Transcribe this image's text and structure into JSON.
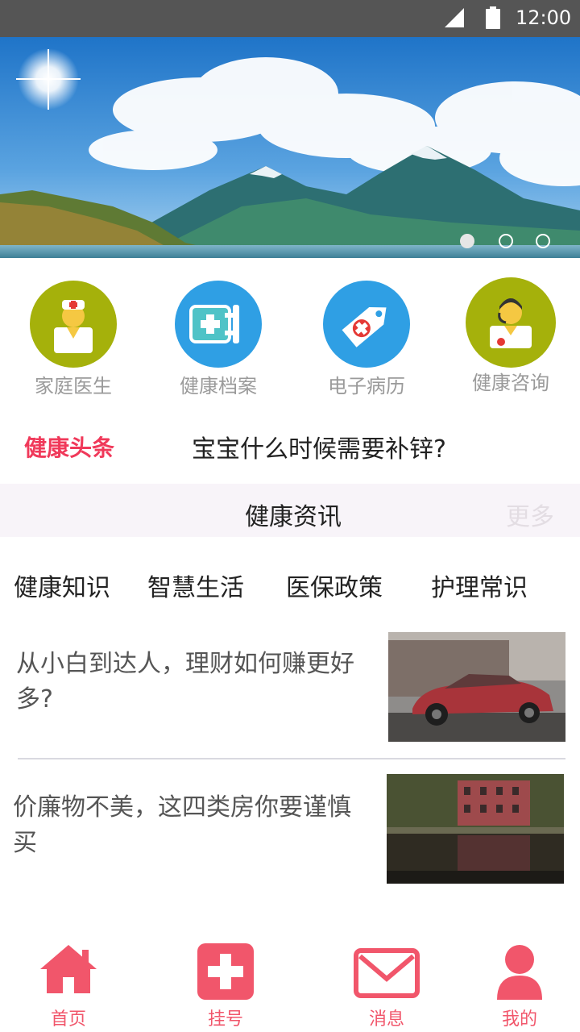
{
  "status_bar": {
    "time": "12:00"
  },
  "banner": {
    "slide_count": 3,
    "active_slide": 1
  },
  "quick_entries": [
    {
      "label": "家庭医生",
      "icon": "family-doctor-icon",
      "color": "#a5b10b"
    },
    {
      "label": "健康档案",
      "icon": "health-record-icon",
      "color": "#2f9fe4"
    },
    {
      "label": "电子病历",
      "icon": "medical-record-tag-icon",
      "color": "#2f9fe4"
    },
    {
      "label": "健康咨询",
      "icon": "health-consult-icon",
      "color": "#a5b10b"
    }
  ],
  "headline": {
    "tag": "健康头条",
    "text": "宝宝什么时候需要补锌?"
  },
  "section": {
    "title": "健康资讯",
    "more": "更多"
  },
  "tabs": [
    "健康知识",
    "智慧生活",
    "医保政策",
    "护理常识"
  ],
  "articles": [
    {
      "title": "从小白到达人，理财如何赚更好多?",
      "thumb": "red-car-photo"
    },
    {
      "title": "价廉物不美，这四类房你要谨慎买",
      "thumb": "red-house-reflection-photo"
    }
  ],
  "bottom_nav": [
    {
      "label": "首页",
      "icon": "home-icon"
    },
    {
      "label": "挂号",
      "icon": "plus-icon"
    },
    {
      "label": "消息",
      "icon": "mail-icon"
    },
    {
      "label": "我的",
      "icon": "user-icon"
    }
  ],
  "colors": {
    "accent": "#f1566b",
    "headline_tag": "#f0395a",
    "status_bar": "#555555"
  }
}
